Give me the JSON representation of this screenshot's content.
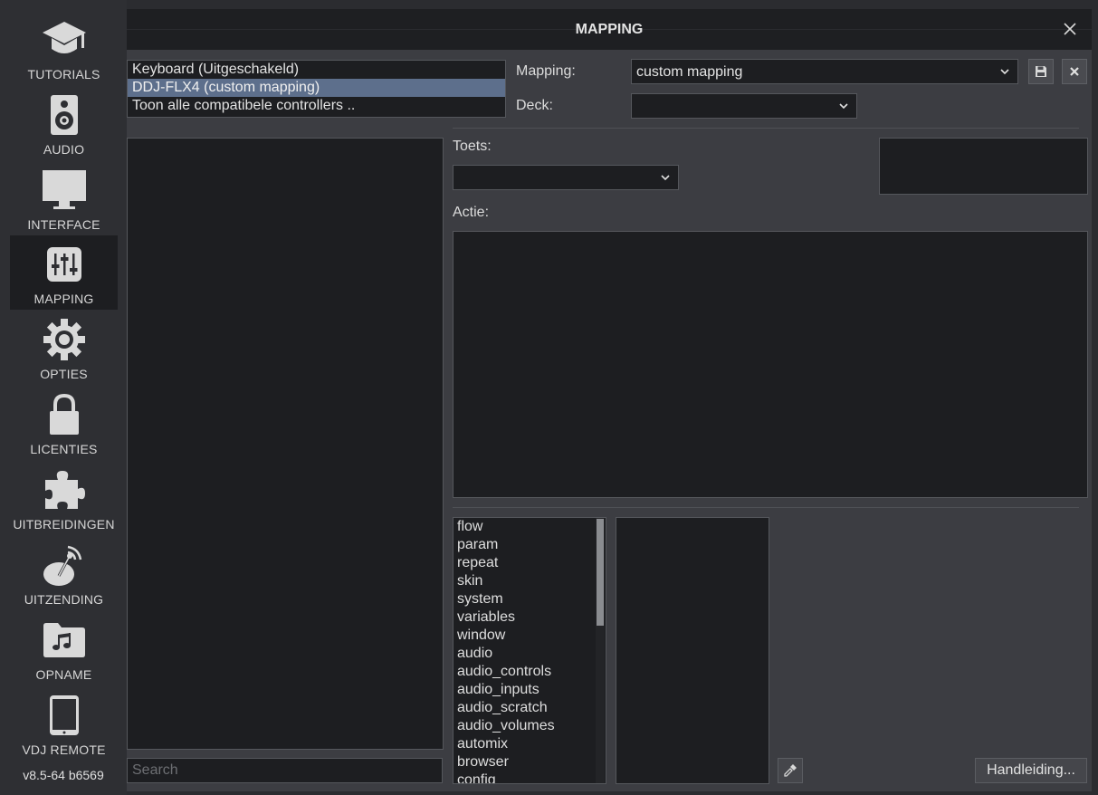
{
  "sidebar": {
    "items": [
      {
        "label": "TUTORIALS",
        "icon": "graduation-cap-icon"
      },
      {
        "label": "AUDIO",
        "icon": "speaker-icon"
      },
      {
        "label": "INTERFACE",
        "icon": "monitor-icon"
      },
      {
        "label": "MAPPING",
        "icon": "sliders-icon",
        "active": true
      },
      {
        "label": "OPTIES",
        "icon": "gear-icon"
      },
      {
        "label": "LICENTIES",
        "icon": "lock-icon"
      },
      {
        "label": "UITBREIDINGEN",
        "icon": "puzzle-icon"
      },
      {
        "label": "UITZENDING",
        "icon": "broadcast-dish-icon"
      },
      {
        "label": "OPNAME",
        "icon": "music-folder-icon"
      },
      {
        "label": "VDJ REMOTE",
        "icon": "tablet-icon"
      }
    ],
    "version": "v8.5-64 b6569"
  },
  "dialog": {
    "title": "MAPPING",
    "controllers": [
      {
        "label": "Keyboard (Uitgeschakeld)"
      },
      {
        "label": "DDJ-FLX4 (custom mapping)",
        "selected": true
      },
      {
        "label": "Toon alle compatibele controllers .."
      }
    ],
    "mapping_label": "Mapping:",
    "mapping_value": "custom mapping",
    "deck_label": "Deck:",
    "deck_value": "",
    "toets_label": "Toets:",
    "toets_value": "",
    "actie_label": "Actie:",
    "verbs": [
      "flow",
      "param",
      "repeat",
      "skin",
      "system",
      "variables",
      "window",
      "audio",
      "audio_controls",
      "audio_inputs",
      "audio_scratch",
      "audio_volumes",
      "automix",
      "browser",
      "config"
    ],
    "search_placeholder": "Search",
    "manual_button": "Handleiding..."
  },
  "colors": {
    "background": "#2b2c30",
    "panel": "#3c3d42",
    "field": "#1d1e21",
    "selection": "#5d6f8c"
  }
}
